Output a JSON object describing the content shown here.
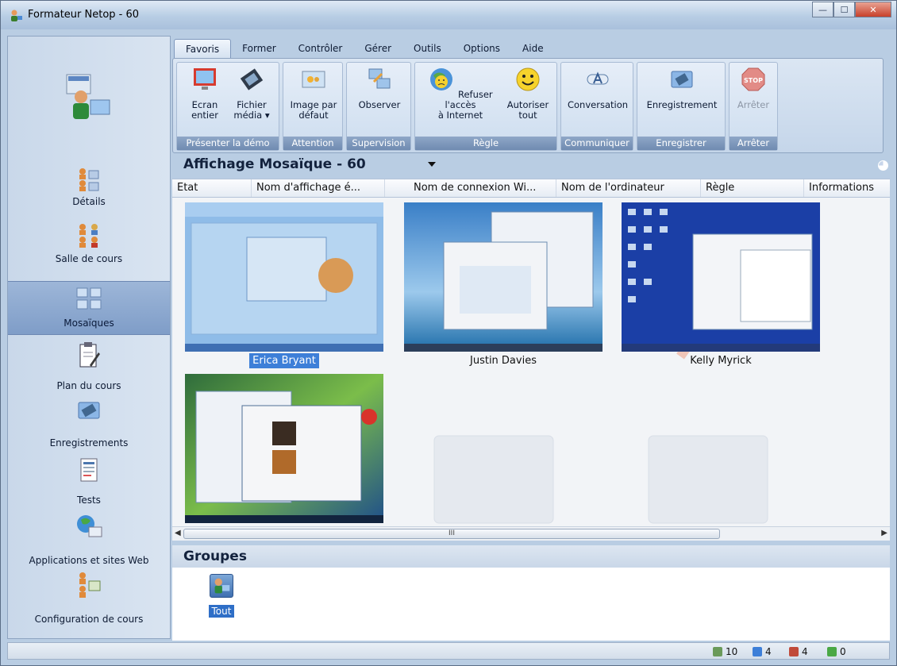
{
  "window": {
    "title": "Formateur Netop - 60"
  },
  "tabs": [
    "Favoris",
    "Former",
    "Contrôler",
    "Gérer",
    "Outils",
    "Options",
    "Aide"
  ],
  "ribbon": {
    "groups": [
      {
        "label": "Présenter la démo",
        "buttons": [
          {
            "label1": "Ecran",
            "label2": "entier",
            "icon": "monitor-icon"
          },
          {
            "label1": "Fichier",
            "label2": "média ▾",
            "icon": "film-icon"
          }
        ]
      },
      {
        "label": "Attention",
        "buttons": [
          {
            "label1": "Image par",
            "label2": "défaut",
            "icon": "image-icon"
          }
        ]
      },
      {
        "label": "Supervision",
        "buttons": [
          {
            "label1": "Observer",
            "label2": "",
            "icon": "observe-icon"
          }
        ]
      },
      {
        "label": "Règle",
        "buttons": [
          {
            "label1": "Refuser l'accès",
            "label2": "à Internet",
            "icon": "globe-sad-icon"
          },
          {
            "label1": "Autoriser",
            "label2": "tout",
            "icon": "smiley-icon"
          }
        ]
      },
      {
        "label": "Communiquer",
        "buttons": [
          {
            "label1": "Conversation",
            "label2": "",
            "icon": "chat-icon"
          }
        ]
      },
      {
        "label": "Enregistrer",
        "buttons": [
          {
            "label1": "Enregistrement",
            "label2": "",
            "icon": "record-icon"
          }
        ]
      },
      {
        "label": "Arrêter",
        "buttons": [
          {
            "label1": "Arrêter",
            "label2": "",
            "icon": "stop-icon"
          }
        ]
      }
    ]
  },
  "nav": [
    {
      "label": "Détails",
      "icon": "details-icon"
    },
    {
      "label": "Salle de cours",
      "icon": "classroom-icon"
    },
    {
      "label": "Mosaïques",
      "icon": "mosaic-icon"
    },
    {
      "label": "Plan du cours",
      "icon": "clipboard-icon"
    },
    {
      "label": "Enregistrements",
      "icon": "recordings-icon"
    },
    {
      "label": "Tests",
      "icon": "tests-icon"
    },
    {
      "label": "Applications et sites Web",
      "icon": "apps-web-icon"
    },
    {
      "label": "Configuration de cours",
      "icon": "course-config-icon"
    }
  ],
  "view": {
    "title": "Affichage Mosaïque - 60"
  },
  "columns": [
    "Etat",
    "Nom d'affichage é...",
    "/",
    "Nom de connexion Wi...",
    "Nom de l'ordinateur",
    "Règle",
    "Informations"
  ],
  "tiles": [
    {
      "name": "Erica Bryant",
      "selected": true
    },
    {
      "name": "Justin Davies",
      "selected": false
    },
    {
      "name": "Kelly Myrick",
      "selected": false
    },
    {
      "name": "",
      "selected": false
    }
  ],
  "scroll": {
    "thumb_label": "III"
  },
  "groups": {
    "title": "Groupes",
    "items": [
      {
        "label": "Tout"
      }
    ]
  },
  "status": {
    "c1": "10",
    "c2": "4",
    "c3": "4",
    "c4": "0"
  },
  "colors": {
    "accent": "#3d7fd8",
    "ribbon_label": "#6f8bb1"
  }
}
